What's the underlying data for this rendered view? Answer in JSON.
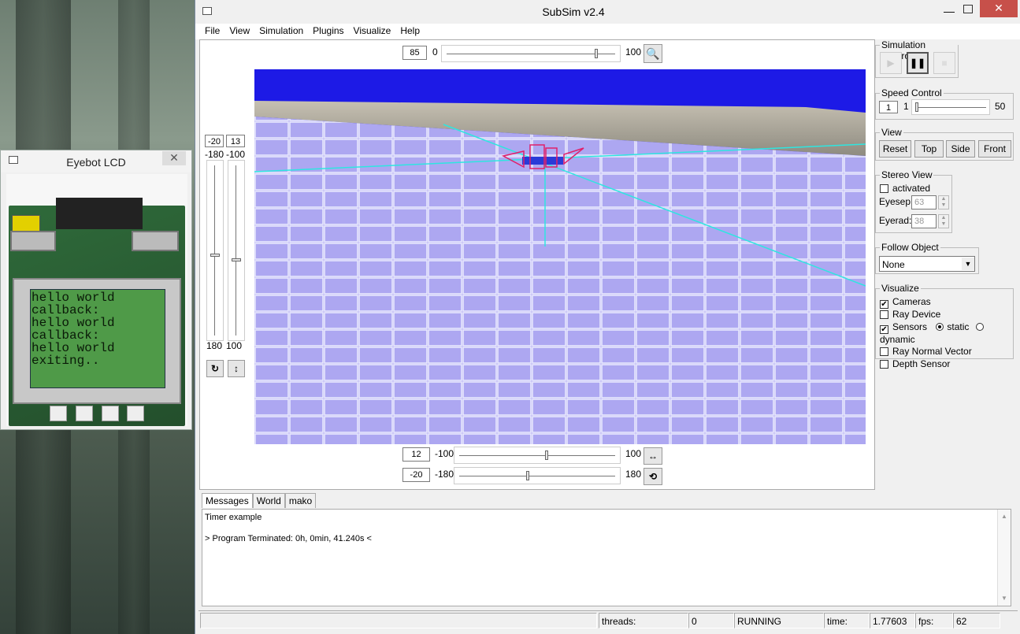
{
  "eyebot": {
    "title": "Eyebot LCD",
    "close_glyph": "✕",
    "lcd_lines": [
      "hello world",
      "callback:",
      "hello world",
      "callback:",
      "hello world",
      "exiting.."
    ]
  },
  "main": {
    "title": "SubSim v2.4",
    "menu": [
      "File",
      "View",
      "Simulation",
      "Plugins",
      "Visualize",
      "Help"
    ],
    "zoom": {
      "value": "85",
      "min": "0",
      "max": "100",
      "fraction": 0.89
    },
    "left_sliders": {
      "a_value": "-20",
      "a_min": "-180",
      "a_max": "180",
      "b_value": "13",
      "b_min": "-100",
      "b_max": "100"
    },
    "bottom_sliders": [
      {
        "value": "12",
        "min": "-100",
        "max": "100",
        "fraction": 0.56
      },
      {
        "value": "-20",
        "min": "-180",
        "max": "180",
        "fraction": 0.44
      }
    ]
  },
  "right": {
    "sim_control_label": "Simulation Control",
    "speed_label": "Speed Control",
    "speed_value": "1",
    "speed_min": "1",
    "speed_max": "50",
    "view_label": "View",
    "view_buttons": [
      "Reset",
      "Top",
      "Side",
      "Front"
    ],
    "stereo_label": "Stereo View",
    "stereo_activated": "activated",
    "eyesep_label": "Eyesep:",
    "eyesep_value": "63",
    "eyerad_label": "Eyerad:",
    "eyerad_value": "38",
    "follow_label": "Follow Object",
    "follow_value": "None",
    "visualize_label": "Visualize",
    "visualize_items": [
      {
        "label": "Cameras",
        "checked": true
      },
      {
        "label": "Ray Device",
        "checked": false
      },
      {
        "label": "Sensors",
        "checked": true
      },
      {
        "label": "Ray Normal Vector",
        "checked": false
      },
      {
        "label": "Depth Sensor",
        "checked": false
      }
    ],
    "static_label": "static",
    "dynamic_label": "dynamic"
  },
  "tabs": [
    "Messages",
    "World",
    "mako"
  ],
  "messages": [
    "Timer example",
    "",
    "> Program Terminated: 0h, 0min, 41.240s <"
  ],
  "status": {
    "threads_label": "threads:",
    "threads_value": "0",
    "state": "RUNNING",
    "time_label": "time:",
    "time_value": "1.77603",
    "fps_label": "fps:",
    "fps_value": "62"
  },
  "colors": {
    "sky": "#1d1ae6",
    "floor": "#8f86e6",
    "lcd": "#4f9a48"
  }
}
